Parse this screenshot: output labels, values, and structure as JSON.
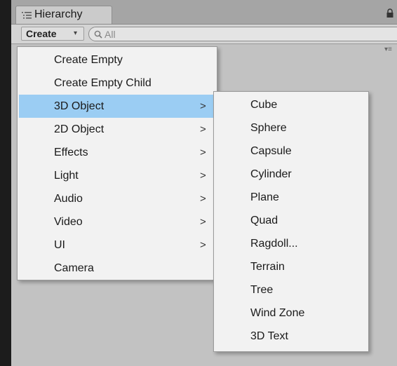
{
  "window": {
    "tab_label": "Hierarchy",
    "tab_icon": "hierarchy-list-icon"
  },
  "toolbar": {
    "create_label": "Create",
    "create_caret": "▾",
    "search_placeholder": "All",
    "search_icon": "search-icon"
  },
  "main_menu": {
    "items": [
      {
        "label": "Create Empty",
        "submenu": false
      },
      {
        "label": "Create Empty Child",
        "submenu": false
      },
      {
        "label": "3D Object",
        "submenu": true,
        "selected": true
      },
      {
        "label": "2D Object",
        "submenu": true
      },
      {
        "label": "Effects",
        "submenu": true
      },
      {
        "label": "Light",
        "submenu": true
      },
      {
        "label": "Audio",
        "submenu": true
      },
      {
        "label": "Video",
        "submenu": true
      },
      {
        "label": "UI",
        "submenu": true
      },
      {
        "label": "Camera",
        "submenu": false
      }
    ],
    "arrow_glyph": ">"
  },
  "sub_menu": {
    "items": [
      {
        "label": "Cube"
      },
      {
        "label": "Sphere"
      },
      {
        "label": "Capsule"
      },
      {
        "label": "Cylinder"
      },
      {
        "label": "Plane"
      },
      {
        "label": "Quad"
      },
      {
        "label": "Ragdoll..."
      },
      {
        "label": "Terrain"
      },
      {
        "label": "Tree"
      },
      {
        "label": "Wind Zone"
      },
      {
        "label": "3D Text"
      }
    ]
  },
  "colors": {
    "selection": "#9bcdf3",
    "panel": "#c2c2c2",
    "menu": "#f2f2f2"
  }
}
